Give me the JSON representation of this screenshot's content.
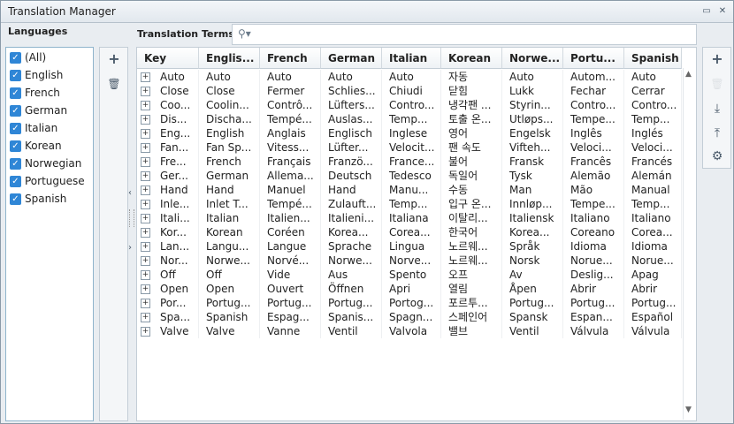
{
  "window": {
    "title": "Translation Manager"
  },
  "languages": {
    "label": "Languages",
    "items": [
      "(All)",
      "English",
      "French",
      "German",
      "Italian",
      "Korean",
      "Norwegian",
      "Portuguese",
      "Spanish"
    ]
  },
  "terms": {
    "label": "Translation Terms",
    "columns": [
      "Key",
      "Englis...",
      "French",
      "German",
      "Italian",
      "Korean",
      "Norwe...",
      "Portu...",
      "Spanish"
    ],
    "rows": [
      [
        "Auto",
        "Auto",
        "Auto",
        "Auto",
        "Auto",
        "자동",
        "Auto",
        "Autom...",
        "Auto"
      ],
      [
        "Close",
        "Close",
        "Fermer",
        "Schlies...",
        "Chiudi",
        "닫힘",
        "Lukk",
        "Fechar",
        "Cerrar"
      ],
      [
        "Coo...",
        "Coolin...",
        "Contrô...",
        "Lüfters...",
        "Contro...",
        "냉각팬 ...",
        "Styrin...",
        "Contro...",
        "Contro..."
      ],
      [
        "Dis...",
        "Discha...",
        "Tempé...",
        "Auslas...",
        "Temp...",
        "토출 온...",
        "Utløps...",
        "Tempe...",
        "Temp..."
      ],
      [
        "Eng...",
        "English",
        "Anglais",
        "Englisch",
        "Inglese",
        "영어",
        "Engelsk",
        "Inglês",
        "Inglés"
      ],
      [
        "Fan...",
        "Fan Sp...",
        "Vitess...",
        "Lüfter...",
        "Velocit...",
        "팬 속도",
        "Vifteh...",
        "Veloci...",
        "Veloci..."
      ],
      [
        "Fre...",
        "French",
        "Français",
        "Franzö...",
        "France...",
        "불어",
        "Fransk",
        "Francês",
        "Francés"
      ],
      [
        "Ger...",
        "German",
        "Allema...",
        "Deutsch",
        "Tedesco",
        "독일어",
        "Tysk",
        "Alemão",
        "Alemán"
      ],
      [
        "Hand",
        "Hand",
        "Manuel",
        "Hand",
        "Manu...",
        "수동",
        "Man",
        "Mão",
        "Manual"
      ],
      [
        "Inle...",
        "Inlet T...",
        "Tempé...",
        "Zulauft...",
        "Temp...",
        "입구 온...",
        "Innløp...",
        "Tempe...",
        "Temp..."
      ],
      [
        "Itali...",
        "Italian",
        "Italien...",
        "Italieni...",
        "Italiana",
        "이탈리...",
        "Italiensk",
        "Italiano",
        "Italiano"
      ],
      [
        "Kor...",
        "Korean",
        "Coréen",
        "Korea...",
        "Corea...",
        "한국어",
        "Korea...",
        "Coreano",
        "Corea..."
      ],
      [
        "Lan...",
        "Langu...",
        "Langue",
        "Sprache",
        "Lingua",
        "노르웨...",
        "Språk",
        "Idioma",
        "Idioma"
      ],
      [
        "Nor...",
        "Norwe...",
        "Norvé...",
        "Norwe...",
        "Norve...",
        "노르웨...",
        "Norsk",
        "Norue...",
        "Norue..."
      ],
      [
        "Off",
        "Off",
        "Vide",
        "Aus",
        "Spento",
        "오프",
        "Av",
        "Deslig...",
        "Apag"
      ],
      [
        "Open",
        "Open",
        "Ouvert",
        "Öffnen",
        "Apri",
        "열림",
        "Åpen",
        "Abrir",
        "Abrir"
      ],
      [
        "Por...",
        "Portug...",
        "Portug...",
        "Portug...",
        "Portog...",
        "포르투...",
        "Portug...",
        "Portug...",
        "Portug..."
      ],
      [
        "Spa...",
        "Spanish",
        "Espag...",
        "Spanis...",
        "Spagn...",
        "스페인어",
        "Spansk",
        "Espan...",
        "Español"
      ],
      [
        "Valve",
        "Valve",
        "Vanne",
        "Ventil",
        "Valvola",
        "밸브",
        "Ventil",
        "Válvula",
        "Válvula"
      ]
    ]
  },
  "icons": {
    "check": "✓",
    "plus": "+",
    "trash": "🗑",
    "search": "⚲",
    "expand": "+",
    "gear": "⚙",
    "import": "⤓",
    "export": "⤒"
  }
}
